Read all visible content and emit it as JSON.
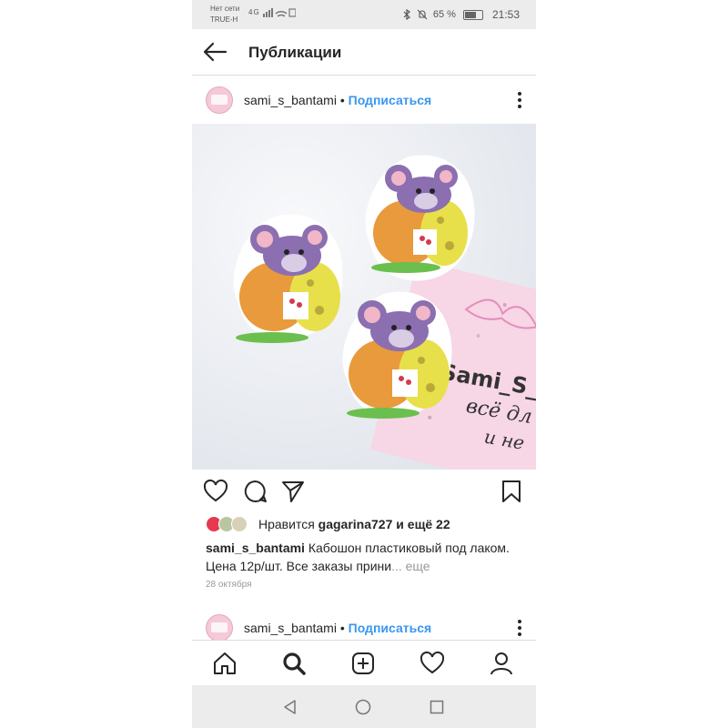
{
  "status_bar": {
    "carrier_line1": "Нет сети",
    "carrier_line2": "TRUE-H",
    "network": "4G",
    "battery_percent": "65 %",
    "time": "21:53"
  },
  "header": {
    "title": "Публикации"
  },
  "post": {
    "username": "sami_s_bantami",
    "separator": "•",
    "follow_label": "Подписаться",
    "liked_by_prefix": "Нравится",
    "liked_by_user": "gagarina727",
    "liked_by_more": "и ещё 22",
    "caption_user": "sami_s_bantami",
    "caption_text": "Кабошон пластиковый под лаком. Цена 12р/шт.  Все заказы прини",
    "caption_more": "... еще",
    "date": "28 октября"
  },
  "next_post": {
    "username": "sami_s_bantami",
    "separator": "•",
    "follow_label": "Подписаться"
  },
  "photo_overlay": {
    "line1": "Sami_S_",
    "line2": "всё дл",
    "line3": "и не"
  },
  "colors": {
    "link_blue": "#3897f0",
    "card_pink": "#f7d6e6",
    "mouse_purple": "#8b6fb0"
  }
}
